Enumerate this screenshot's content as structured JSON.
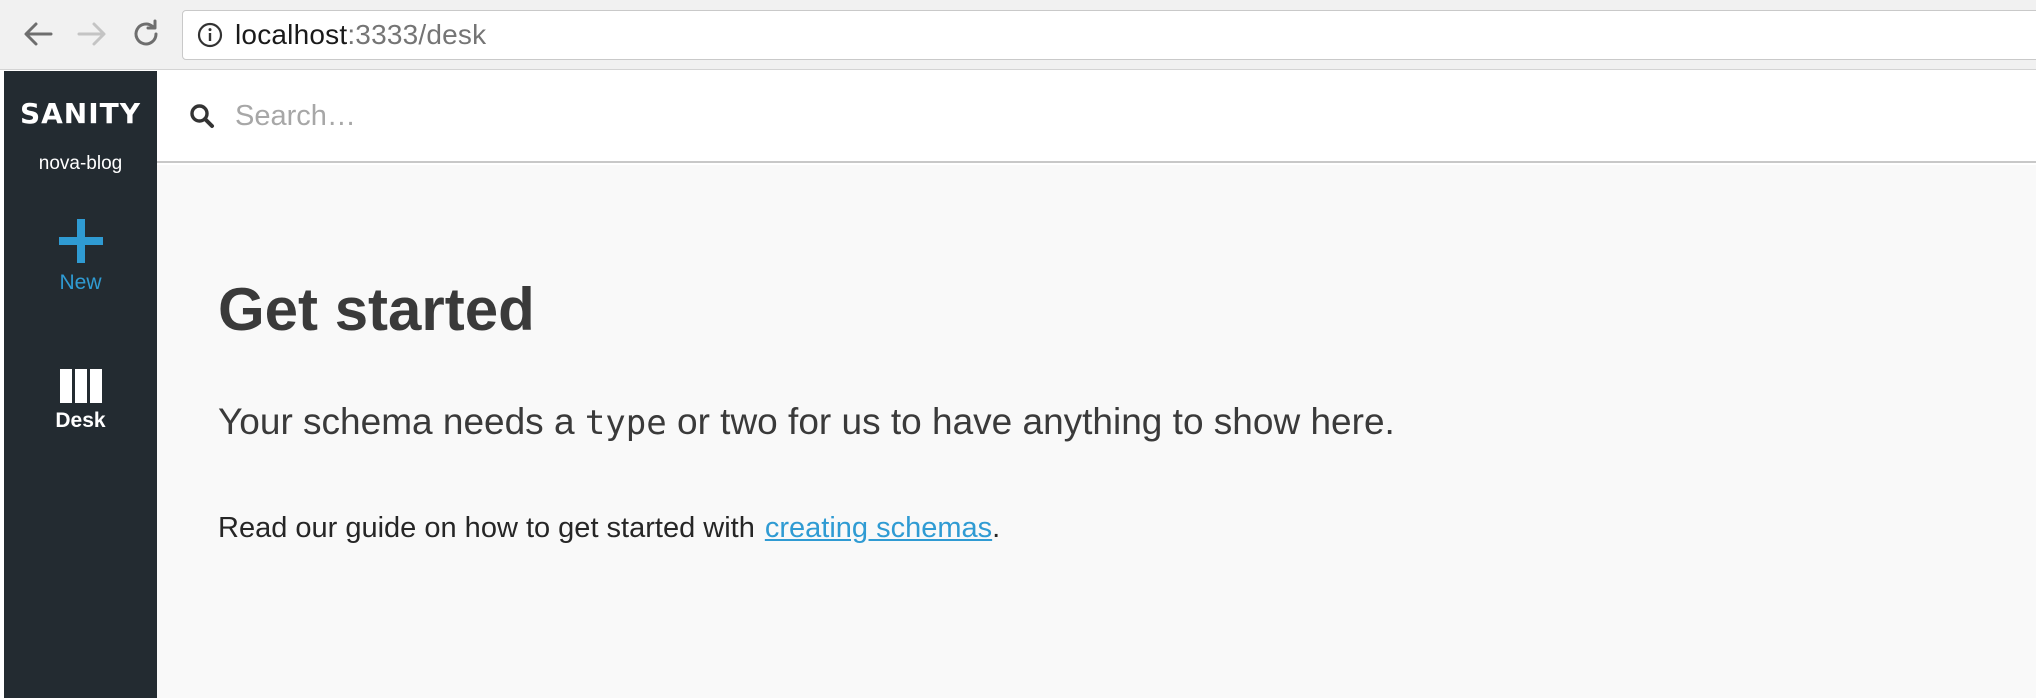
{
  "browser": {
    "url_host": "localhost",
    "url_path": ":3333/desk"
  },
  "sidebar": {
    "brand": "SANITY",
    "project": "nova-blog",
    "tools": [
      {
        "label": "New",
        "icon": "plus-icon",
        "color": "#2f9bd3"
      },
      {
        "label": "Desk",
        "icon": "columns-icon",
        "color": "#ffffff"
      }
    ]
  },
  "search": {
    "placeholder": "Search…"
  },
  "main": {
    "title": "Get started",
    "lead_before": "Your schema needs a ",
    "lead_code": "type",
    "lead_after": " or two for us to have anything to show here.",
    "guide_text": "Read our guide on how to get started with",
    "guide_link": "creating schemas",
    "guide_end": "."
  },
  "colors": {
    "sidebar_bg": "#232b31",
    "accent": "#2f9bd3",
    "content_bg": "#f9f9f9",
    "text": "#3a3a3a"
  }
}
